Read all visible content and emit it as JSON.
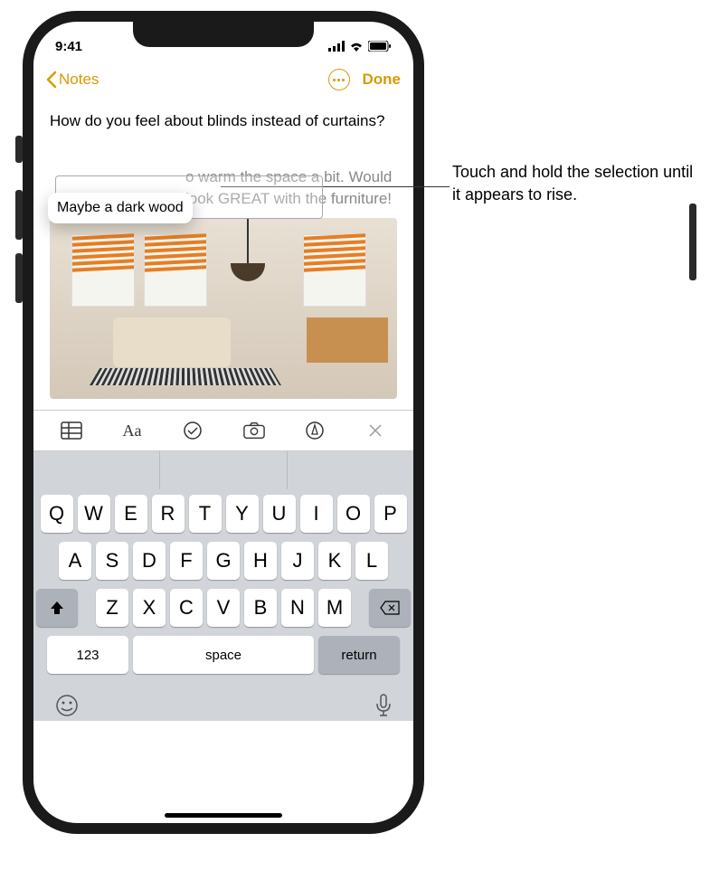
{
  "status": {
    "time": "9:41"
  },
  "nav": {
    "back": "Notes",
    "done": "Done"
  },
  "note": {
    "line1": "How do you feel about blinds instead of curtains?",
    "selected": "Maybe a dark wood",
    "line2_partial": "o warm the space a bit. Would look GREAT with the furniture!"
  },
  "keyboard": {
    "row1": [
      "Q",
      "W",
      "E",
      "R",
      "T",
      "Y",
      "U",
      "I",
      "O",
      "P"
    ],
    "row2": [
      "A",
      "S",
      "D",
      "F",
      "G",
      "H",
      "J",
      "K",
      "L"
    ],
    "row3": [
      "Z",
      "X",
      "C",
      "V",
      "B",
      "N",
      "M"
    ],
    "numkey": "123",
    "space": "space",
    "return": "return"
  },
  "callout": "Touch and hold the selection until it appears to rise."
}
